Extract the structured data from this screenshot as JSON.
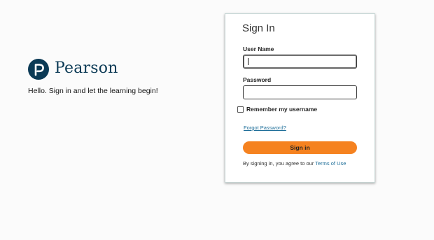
{
  "brand": {
    "name": "Pearson",
    "logo_icon": "pearson-p-logo",
    "brand_color": "#0b3a55",
    "tagline": "Hello. Sign in and let the learning begin!"
  },
  "signin": {
    "title": "Sign In",
    "username_label": "User Name",
    "username_value": "",
    "password_label": "Password",
    "password_value": "",
    "remember_label": "Remember my username",
    "remember_checked": false,
    "forgot_link": "Forgot Password?",
    "button_label": "Sign in",
    "button_color": "#f58220",
    "terms_prefix": "By signing in, you agree to our",
    "terms_link": "Terms of Use",
    "link_color": "#1e6e99"
  }
}
